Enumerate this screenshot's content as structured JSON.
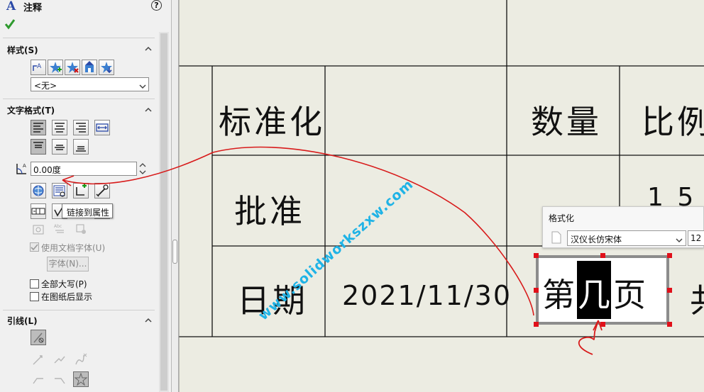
{
  "panel": {
    "title": "注释",
    "style_section": {
      "title": "样式(S)",
      "dropdown_value": "<无>"
    },
    "text_format_section": {
      "title": "文字格式(T)",
      "angle_value": "0.00度",
      "tooltip": "链接到属性",
      "use_doc_font_label": "使用文档字体(U)",
      "font_button_label": "字体(N)...",
      "all_caps_label": "全部大写(P)",
      "show_behind_sheet_label": "在图纸后显示"
    },
    "leader_section": {
      "title": "引线(L)"
    }
  },
  "drawing": {
    "cells": {
      "standardization": "标准化",
      "quantity": "数量",
      "scale_partial": "比例",
      "approve": "批准",
      "value_partial": "1 5",
      "date": "日期",
      "date_value": "2021/11/30",
      "sheet_pre": "第",
      "sheet_highlight": "几",
      "sheet_post": "页",
      "edge_partial": "共"
    },
    "watermark": "www.solidworkszxw.com"
  },
  "format_popup": {
    "title": "格式化",
    "font_value": "汉仪长仿宋体",
    "size_value": "12"
  }
}
